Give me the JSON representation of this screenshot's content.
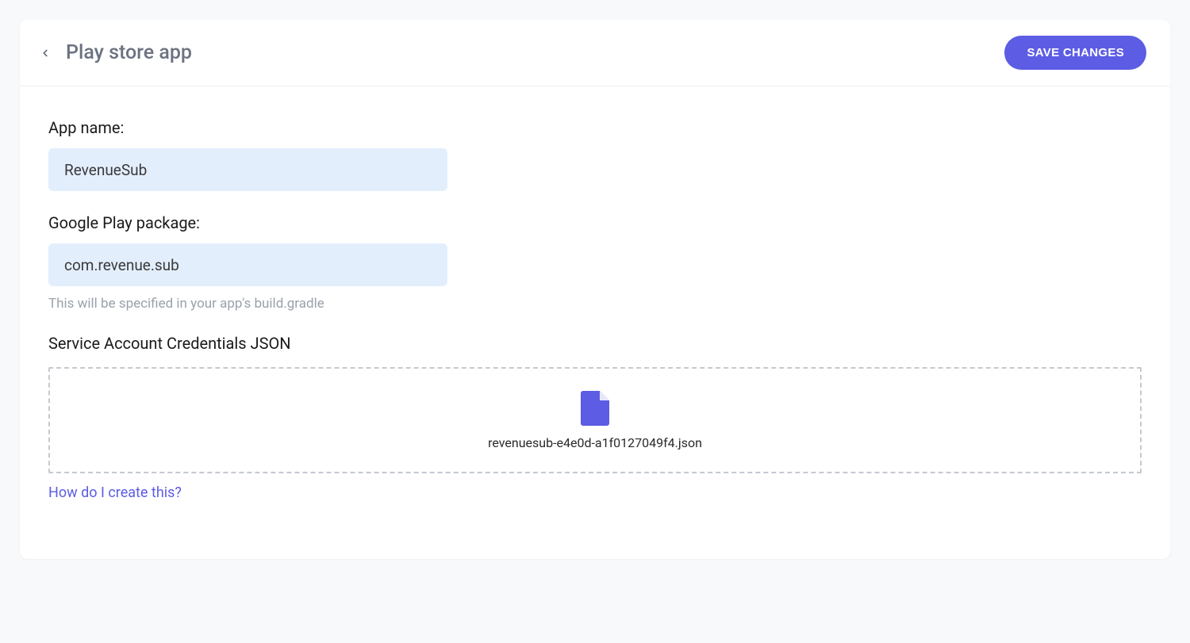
{
  "header": {
    "title": "Play store app",
    "save_button": "SAVE CHANGES"
  },
  "form": {
    "app_name": {
      "label": "App name:",
      "value": "RevenueSub"
    },
    "package": {
      "label": "Google Play package:",
      "value": "com.revenue.sub",
      "helper": "This will be specified in your app's build.gradle"
    },
    "credentials": {
      "label": "Service Account Credentials JSON",
      "file_name": "revenuesub-e4e0d-a1f0127049f4.json",
      "help_link": "How do I create this?"
    }
  }
}
